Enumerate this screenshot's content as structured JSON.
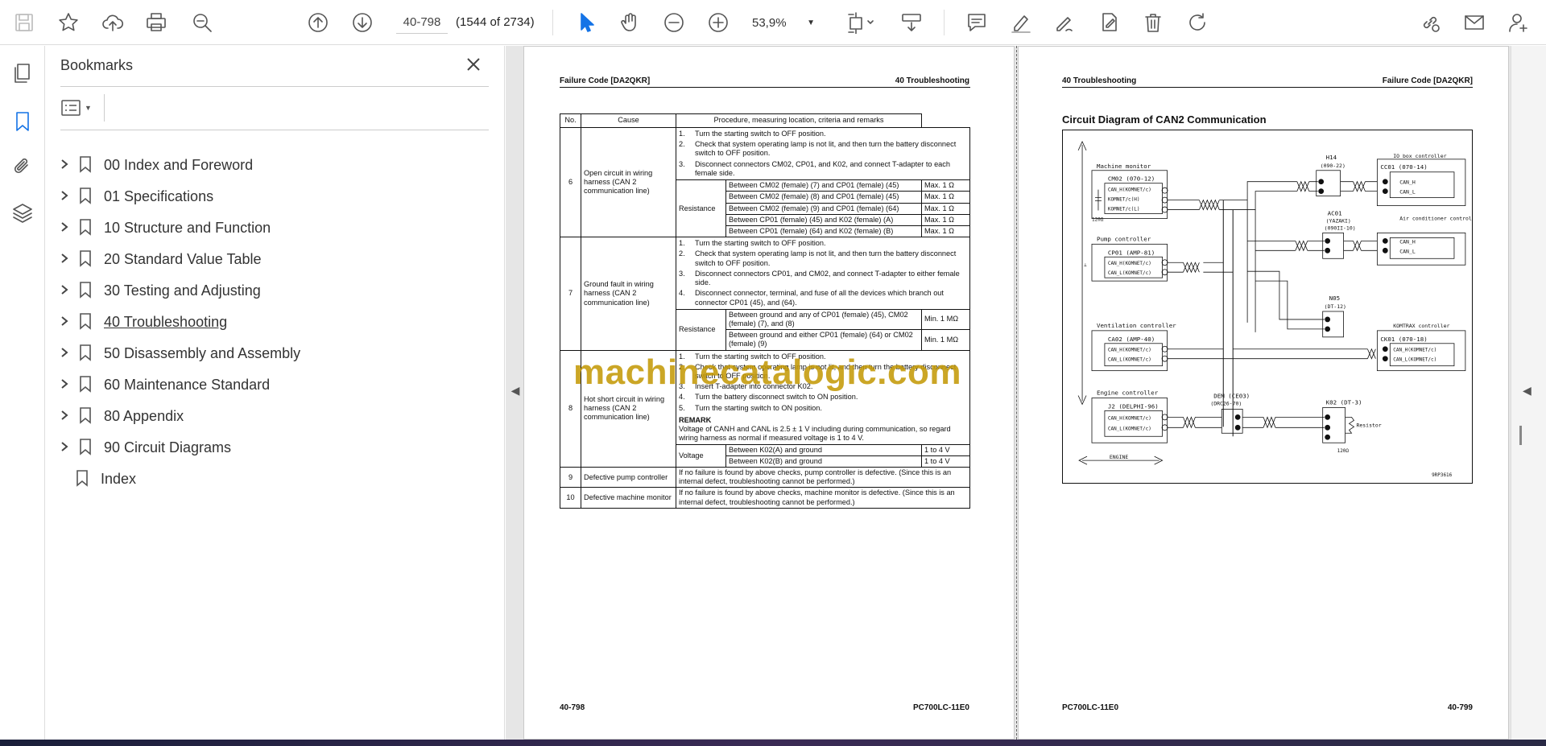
{
  "toolbar": {
    "page_value": "40-798",
    "page_count": "(1544 of 2734)",
    "zoom": "53,9%"
  },
  "bookmarks": {
    "title": "Bookmarks",
    "items": [
      {
        "label": "00 Index and Foreword",
        "has_children": true
      },
      {
        "label": "01 Specifications",
        "has_children": true
      },
      {
        "label": "10 Structure and Function",
        "has_children": true
      },
      {
        "label": "20 Standard Value Table",
        "has_children": true
      },
      {
        "label": "30 Testing and Adjusting",
        "has_children": true
      },
      {
        "label": "40 Troubleshooting",
        "has_children": true,
        "current": true
      },
      {
        "label": "50 Disassembly and Assembly",
        "has_children": true
      },
      {
        "label": "60 Maintenance Standard",
        "has_children": true
      },
      {
        "label": "80 Appendix",
        "has_children": true
      },
      {
        "label": "90 Circuit Diagrams",
        "has_children": true
      },
      {
        "label": "Index",
        "has_children": false
      }
    ]
  },
  "left_page": {
    "header_left": "Failure Code [DA2QKR]",
    "header_right": "40 Troubleshooting",
    "footer_left": "40-798",
    "footer_right": "PC700LC-11E0",
    "table": {
      "headers": [
        "No.",
        "Cause",
        "Procedure, measuring location, criteria and remarks"
      ],
      "row6": {
        "no": "6",
        "cause": "Open circuit in wiring harness (CAN 2 communication line)",
        "steps": [
          {
            "n": "1.",
            "t": "Turn the starting switch to OFF position."
          },
          {
            "n": "2.",
            "t": "Check that system operating lamp is not lit, and then turn the battery disconnect switch to OFF position."
          },
          {
            "n": "3.",
            "t": "Disconnect connectors CM02, CP01, and K02, and connect T-adapter to each female side."
          }
        ],
        "meas_label": "Resistance",
        "meas": [
          {
            "loc": "Between CM02 (female) (7) and CP01 (female) (45)",
            "val": "Max. 1 Ω"
          },
          {
            "loc": "Between CM02 (female) (8) and CP01 (female) (45)",
            "val": "Max. 1 Ω"
          },
          {
            "loc": "Between CM02 (female) (9) and CP01 (female) (64)",
            "val": "Max. 1 Ω"
          },
          {
            "loc": "Between CP01 (female) (45) and K02 (female) (A)",
            "val": "Max. 1 Ω"
          },
          {
            "loc": "Between CP01 (female) (64) and K02 (female) (B)",
            "val": "Max. 1 Ω"
          }
        ]
      },
      "row7": {
        "no": "7",
        "cause": "Ground fault in wiring harness (CAN 2 communication line)",
        "steps": [
          {
            "n": "1.",
            "t": "Turn the starting switch to OFF position."
          },
          {
            "n": "2.",
            "t": "Check that system operating lamp is not lit, and then turn the battery disconnect switch to OFF position."
          },
          {
            "n": "3.",
            "t": "Disconnect connectors CP01, and CM02, and connect T-adapter to either female side."
          },
          {
            "n": "4.",
            "t": "Disconnect connector, terminal, and fuse of all the devices which branch out connector CP01 (45), and (64)."
          }
        ],
        "meas_label": "Resistance",
        "meas": [
          {
            "loc": "Between ground and any of CP01 (female) (45), CM02 (female) (7), and (8)",
            "val": "Min. 1 MΩ"
          },
          {
            "loc": "Between ground and either CP01 (female) (64) or CM02 (female) (9)",
            "val": "Min. 1 MΩ"
          }
        ]
      },
      "row8": {
        "no": "8",
        "cause": "Hot short circuit in wiring harness (CAN 2 communication line)",
        "steps": [
          {
            "n": "1.",
            "t": "Turn the starting switch to OFF position."
          },
          {
            "n": "2.",
            "t": "Check that system operating lamp is not lit, and then turn the battery disconnect switch to OFF position."
          },
          {
            "n": "3.",
            "t": "Insert T-adapter into connector K02."
          },
          {
            "n": "4.",
            "t": "Turn the battery disconnect switch to ON position."
          },
          {
            "n": "5.",
            "t": "Turn the starting switch to ON position."
          }
        ],
        "remark_title": "REMARK",
        "remark_text": "Voltage of CANH and CANL is 2.5 ± 1 V including during communication, so regard wiring harness as normal if measured voltage is 1 to 4 V.",
        "meas_label": "Voltage",
        "meas": [
          {
            "loc": "Between K02(A) and ground",
            "val": "1 to 4 V"
          },
          {
            "loc": "Between K02(B) and ground",
            "val": "1 to 4 V"
          }
        ]
      },
      "row9": {
        "no": "9",
        "cause": "Defective pump controller",
        "text": "If no failure is found by above checks, pump controller is defective. (Since this is an internal defect, troubleshooting cannot be performed.)"
      },
      "row10": {
        "no": "10",
        "cause": "Defective machine monitor",
        "text": "If no failure is found by above checks, machine monitor is defective. (Since this is an internal defect, troubleshooting cannot be performed.)"
      }
    }
  },
  "right_page": {
    "header_left": "40 Troubleshooting",
    "header_right": "Failure Code [DA2QKR]",
    "footer_left": "PC700LC-11E0",
    "footer_right": "40-799",
    "diagram_title": "Circuit Diagram of CAN2 Communication",
    "diagram": {
      "machine_monitor": "Machine monitor",
      "cm02": "CM02 (070-12)",
      "cm02_pins": [
        "CAN_H(KOMNET/c)",
        "KOMNET/c(H)",
        "KOMNET/c(L)"
      ],
      "r120_left": "120Ω",
      "h14": "H14",
      "h14_sub": "(090-22)",
      "cc01": "CC01 (070-14)",
      "io_box": "IO box controller",
      "can_h": "CAN_H",
      "can_l": "CAN_L",
      "pump": "Pump controller",
      "cp01": "CP01 (AMP-81)",
      "cp01_pins": [
        "CAN_H(KOMNET/c)",
        "CAN_L(KOMNET/c)"
      ],
      "ac01": "AC01",
      "ac01_sub": "(YAZAKI)",
      "ac01_sub2": "(090II-10)",
      "aircon": "Air conditioner controller",
      "n05": "N05",
      "n05_sub": "(DT-12)",
      "ventilation": "Ventilation controller",
      "ca02": "CA02 (AMP-40)",
      "ca02_pins": [
        "CAN_H(KOMNET/c)",
        "CAN_L(KOMNET/c)"
      ],
      "komtrax": "KOMTRAX controller",
      "ck01": "CK01 (070-18)",
      "ck01_pins": [
        "CAN_H(KOMNET/c)",
        "CAN_L(KOMNET/c)"
      ],
      "engine_ctrl": "Engine controller",
      "j2": "J2 (DELPHI-96)",
      "j2_pins": [
        "CAN_H(KOMNET/c)",
        "CAN_L(KOMNET/c)"
      ],
      "dem": "DEM (CE03)",
      "dem_sub": "(DRC26-70)",
      "k02": "K02 (DT-3)",
      "resistor": "Resistor",
      "r120_right": "120Ω",
      "engine": "ENGINE",
      "code": "9RP3616"
    }
  },
  "watermark": "machinecatalogic.com"
}
